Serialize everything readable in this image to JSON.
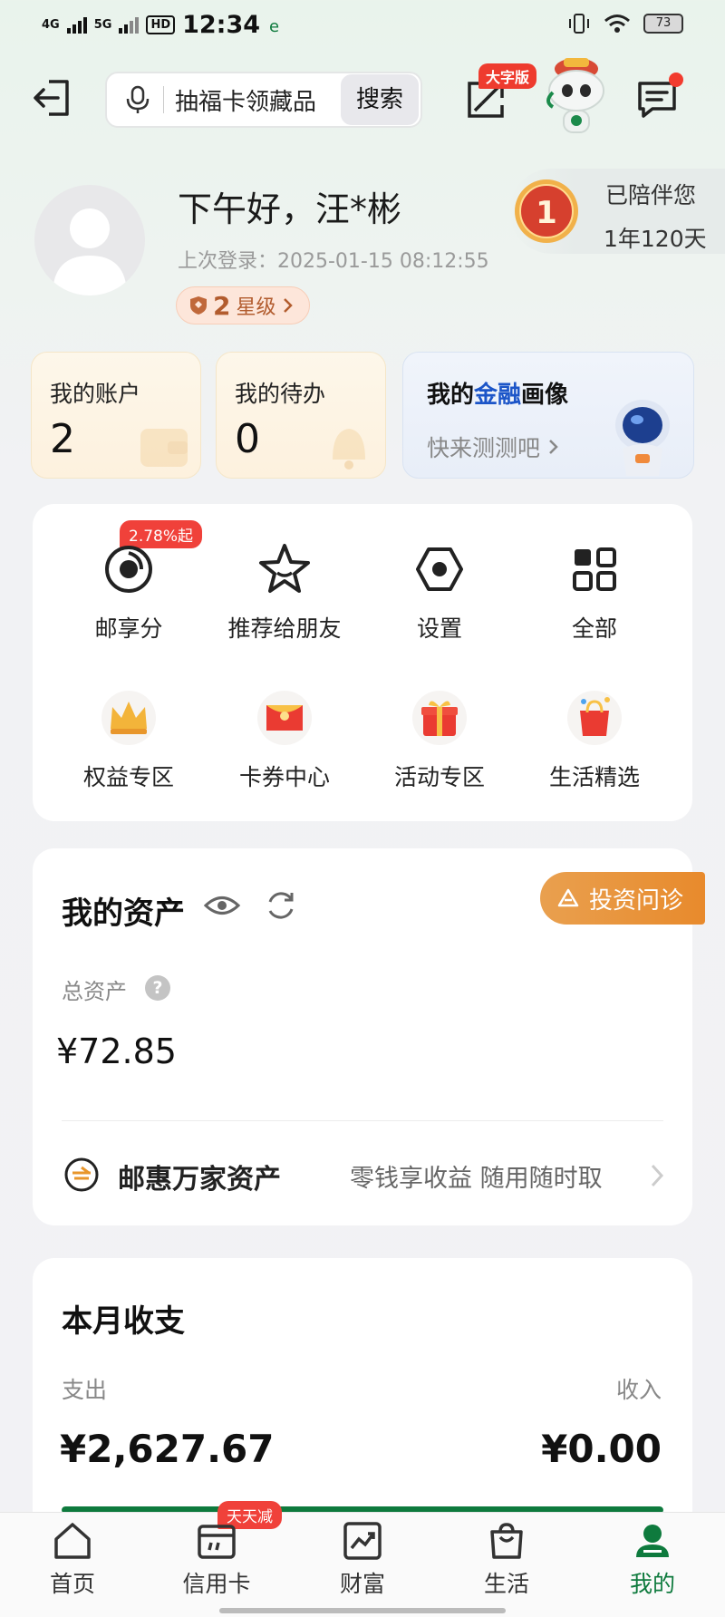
{
  "status_bar": {
    "network_1": "4G",
    "network_2": "5G",
    "hd": "HD",
    "time": "12:34",
    "battery": "73"
  },
  "header": {
    "search_text": "抽福卡领藏品",
    "search_button": "搜索",
    "big_text_badge": "大字版"
  },
  "profile": {
    "greeting": "下午好，汪*彬",
    "last_login": "上次登录：2025-01-15 08:12:55",
    "star_level_num": "2",
    "star_level_text": "星级",
    "companion_line1": "已陪伴您",
    "companion_line2": "1年120天"
  },
  "quick_cards": {
    "account_label": "我的账户",
    "account_value": "2",
    "todo_label": "我的待办",
    "todo_value": "0",
    "finance_title_a": "我的",
    "finance_title_b": "金融",
    "finance_title_c": "画像",
    "finance_sub": "快来测测吧"
  },
  "functions": {
    "rate_badge": "2.78%起",
    "items": [
      {
        "label": "邮享分",
        "icon": "coin-icon"
      },
      {
        "label": "推荐给朋友",
        "icon": "star-icon"
      },
      {
        "label": "设置",
        "icon": "hexagon-settings-icon"
      },
      {
        "label": "全部",
        "icon": "grid-icon"
      },
      {
        "label": "权益专区",
        "icon": "crown-icon"
      },
      {
        "label": "卡券中心",
        "icon": "coupon-icon"
      },
      {
        "label": "活动专区",
        "icon": "gift-icon"
      },
      {
        "label": "生活精选",
        "icon": "shopping-bag-icon"
      }
    ]
  },
  "assets": {
    "title": "我的资产",
    "invest_button": "投资问诊",
    "total_label": "总资产",
    "help": "?",
    "total_value": "¥72.85",
    "yhwj_title": "邮惠万家资产",
    "yhwj_desc": "零钱享收益 随用随时取"
  },
  "monthly": {
    "title": "本月收支",
    "expense_label": "支出",
    "income_label": "收入",
    "expense_value": "¥2,627.67",
    "income_value": "¥0.00",
    "expense_ratio": 1.0
  },
  "bottom_nav": {
    "badge": "天天减",
    "items": [
      {
        "label": "首页",
        "icon": "home-icon"
      },
      {
        "label": "信用卡",
        "icon": "calendar-card-icon"
      },
      {
        "label": "财富",
        "icon": "chart-icon"
      },
      {
        "label": "生活",
        "icon": "bag-icon"
      },
      {
        "label": "我的",
        "icon": "user-icon"
      }
    ],
    "active": "我的"
  },
  "colors": {
    "brand_green": "#0e7a3d",
    "badge_red": "#f0413a",
    "invest_orange": "#e88a2c",
    "finance_blue": "#1c55c8"
  }
}
